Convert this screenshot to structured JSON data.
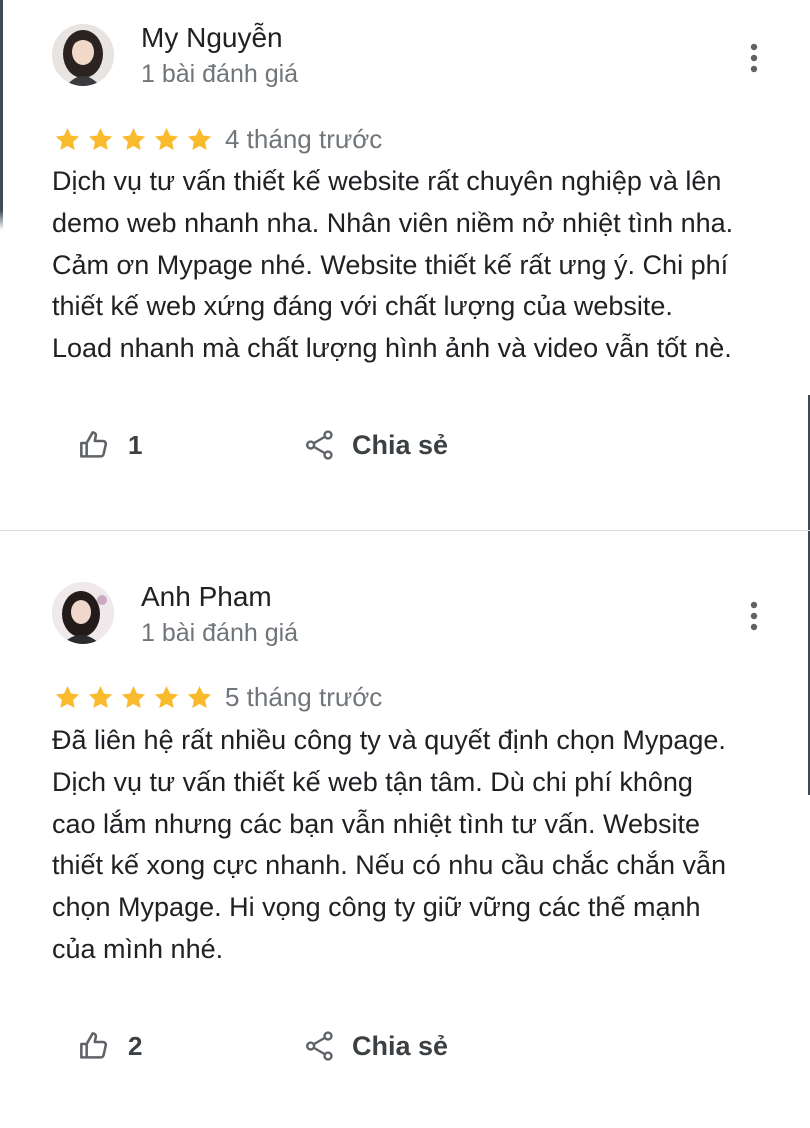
{
  "colors": {
    "star": "#f9bb2d",
    "text": "#202124",
    "secondary": "#70757a",
    "icon": "#5f6368"
  },
  "reviews": [
    {
      "name": "My Nguyễn",
      "review_count": "1 bài đánh giá",
      "rating": 5,
      "date": "4 tháng trước",
      "lines": [
        "Dịch vụ tư vấn thiết kế website rất chuyên nghiệp và lên",
        "demo web nhanh nha. Nhân viên niềm nở nhiệt tình nha.",
        "Cảm ơn Mypage nhé. Website thiết kế rất ưng ý. Chi phí",
        "thiết kế web xứng đáng với chất lượng của website.",
        "Load nhanh mà chất lượng hình ảnh và video vẫn tốt nè."
      ],
      "likes": "1",
      "share_label": "Chia sẻ"
    },
    {
      "name": "Anh Pham",
      "review_count": "1 bài đánh giá",
      "rating": 5,
      "date": "5 tháng trước",
      "lines": [
        "Đã liên hệ rất nhiều công ty và quyết định chọn Mypage.",
        "Dịch vụ tư vấn thiết kế web tận tâm. Dù chi phí không",
        "cao lắm nhưng các bạn vẫn nhiệt tình tư vấn. Website",
        "thiết kế xong cực nhanh. Nếu có nhu cầu chắc chắn vẫn",
        "chọn Mypage. Hi vọng công ty giữ vững các thế mạnh",
        "của mình nhé."
      ],
      "likes": "2",
      "share_label": "Chia sẻ"
    }
  ]
}
